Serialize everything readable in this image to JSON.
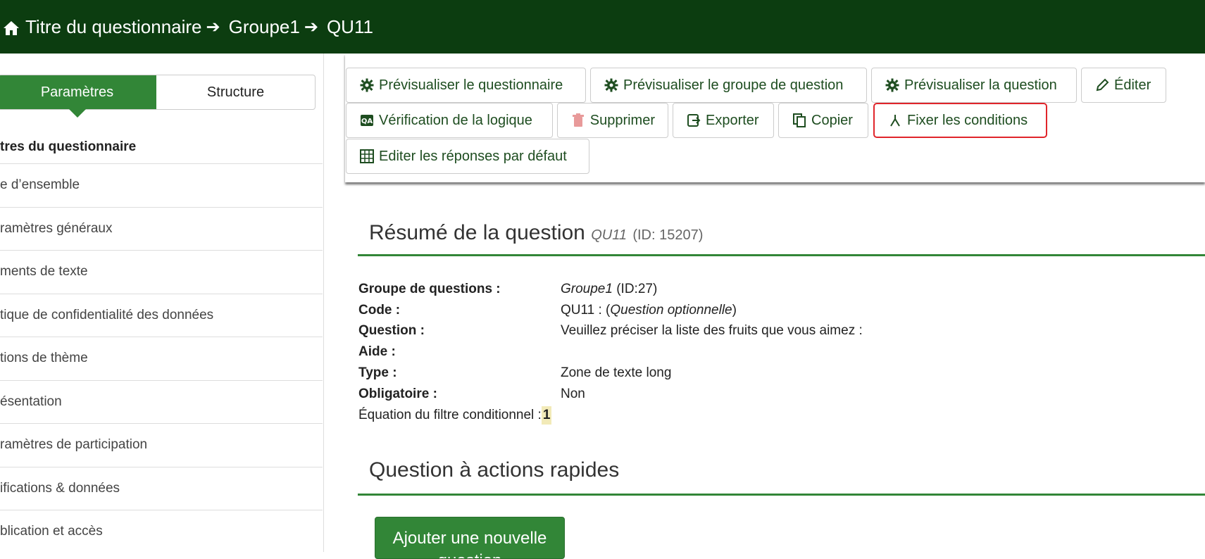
{
  "breadcrumb": {
    "items": [
      "Titre du questionnaire",
      "Groupe1",
      "QU11"
    ]
  },
  "sidebar": {
    "tabs": [
      "Paramètres",
      "Structure"
    ],
    "heading": "tres du questionnaire",
    "items": [
      "e d’ensemble",
      "ramètres généraux",
      "ments de texte",
      "tique de confidentialité des données",
      "tions de thème",
      "ésentation",
      "ramètres de participation",
      "ifications & données",
      "blication et accès"
    ]
  },
  "toolbar": {
    "preview_survey": "Prévisualiser le questionnaire",
    "preview_group": "Prévisualiser le groupe de question",
    "preview_question": "Prévisualiser la question",
    "edit": "Éditer",
    "logic_check": "Vérification de la logique",
    "delete": "Supprimer",
    "export": "Exporter",
    "copy": "Copier",
    "set_conditions": "Fixer les conditions",
    "edit_defaults": "Editer les réponses par défaut"
  },
  "summary": {
    "title": "Résumé de la question",
    "code": "QU11",
    "id_text": "(ID: 15207)",
    "group_label": "Groupe de questions :",
    "group_name": "Groupe1",
    "group_id": "(ID:27)",
    "code_label": "Code :",
    "code_prefix": "QU11 : (",
    "code_optional": "Question optionnelle",
    "code_suffix": ")",
    "question_label": "Question :",
    "question_value": "Veuillez préciser la liste des fruits que vous aimez :",
    "help_label": "Aide :",
    "help_value": "",
    "type_label": "Type :",
    "type_value": "Zone de texte long",
    "mandatory_label": "Obligatoire :",
    "mandatory_value": "Non",
    "condition_label": "Équation du filtre conditionnel :",
    "condition_value": "1"
  },
  "quick_actions": {
    "title": "Question à actions rapides",
    "add_button": "Ajouter une nouvelle question"
  },
  "colors": {
    "topbar": "#0c3d10",
    "accent": "#328637",
    "highlight_border": "#e0252b"
  }
}
